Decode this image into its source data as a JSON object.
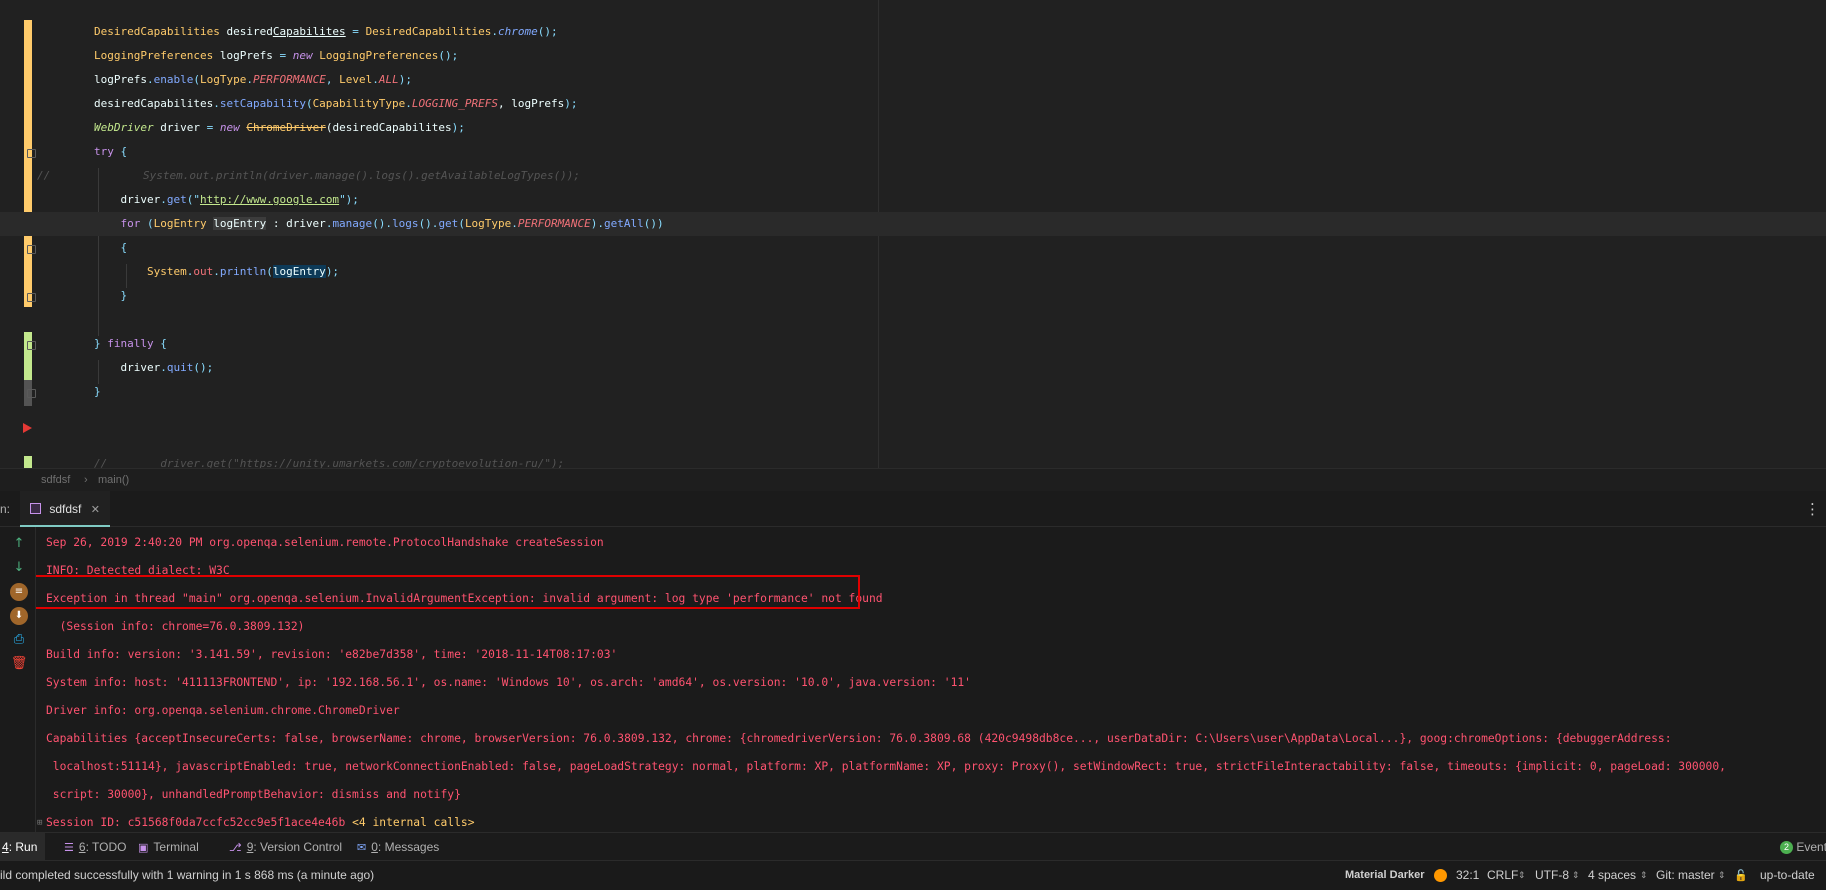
{
  "editor": {
    "lines": [
      [
        {
          "t": "DesiredCapabilities",
          "c": "#ffcb6b"
        },
        {
          "t": " desired",
          "c": "#eeffff"
        },
        {
          "t": "Capabilites",
          "c": "#eeffff",
          "u": true
        },
        {
          "t": " = ",
          "c": "#89ddff"
        },
        {
          "t": "DesiredCapabilities",
          "c": "#ffcb6b"
        },
        {
          "t": ".",
          "c": "#89ddff"
        },
        {
          "t": "chrome",
          "c": "#82aaff",
          "i": true
        },
        {
          "t": "();",
          "c": "#89ddff"
        }
      ],
      [
        {
          "t": "LoggingPreferences",
          "c": "#ffcb6b"
        },
        {
          "t": " logPrefs ",
          "c": "#eeffff"
        },
        {
          "t": "= ",
          "c": "#89ddff"
        },
        {
          "t": "new ",
          "c": "#c792ea",
          "i": true
        },
        {
          "t": "LoggingPreferences",
          "c": "#ffcb6b"
        },
        {
          "t": "();",
          "c": "#89ddff"
        }
      ],
      [
        {
          "t": "logPrefs",
          "c": "#eeffff"
        },
        {
          "t": ".",
          "c": "#89ddff"
        },
        {
          "t": "enable",
          "c": "#82aaff"
        },
        {
          "t": "(",
          "c": "#89ddff"
        },
        {
          "t": "LogType",
          "c": "#ffcb6b"
        },
        {
          "t": ".",
          "c": "#89ddff"
        },
        {
          "t": "PERFORMANCE",
          "c": "#f07178",
          "i": true
        },
        {
          "t": ", ",
          "c": "#89ddff"
        },
        {
          "t": "Level",
          "c": "#ffcb6b"
        },
        {
          "t": ".",
          "c": "#89ddff"
        },
        {
          "t": "ALL",
          "c": "#f07178",
          "i": true
        },
        {
          "t": ");",
          "c": "#89ddff"
        }
      ],
      [
        {
          "t": "desiredCapabilites",
          "c": "#eeffff"
        },
        {
          "t": ".",
          "c": "#89ddff"
        },
        {
          "t": "setCapability",
          "c": "#82aaff"
        },
        {
          "t": "(",
          "c": "#89ddff"
        },
        {
          "t": "CapabilityType",
          "c": "#ffcb6b"
        },
        {
          "t": ".",
          "c": "#89ddff"
        },
        {
          "t": "LOGGING_PREFS",
          "c": "#f07178",
          "i": true
        },
        {
          "t": ", logPrefs",
          "c": "#eeffff"
        },
        {
          "t": ");",
          "c": "#89ddff"
        }
      ],
      [
        {
          "t": "WebDriver",
          "c": "#c3e88d",
          "i": true
        },
        {
          "t": " driver ",
          "c": "#eeffff"
        },
        {
          "t": "= ",
          "c": "#89ddff"
        },
        {
          "t": "new ",
          "c": "#c792ea",
          "i": true
        },
        {
          "t": "ChromeDriver",
          "c": "#ffcb6b",
          "s": true
        },
        {
          "t": "(desiredCapabilites",
          "c": "#eeffff"
        },
        {
          "t": ");",
          "c": "#89ddff"
        }
      ],
      [
        {
          "t": "try ",
          "c": "#c792ea"
        },
        {
          "t": "{",
          "c": "#89ddff"
        }
      ],
      [
        {
          "t": "//",
          "c": "#545454",
          "i": true
        },
        {
          "t": "              System.out.println(driver.manage().logs().getAvailableLogTypes());",
          "c": "#545454",
          "i": true
        }
      ],
      [
        {
          "t": "    driver",
          "c": "#eeffff"
        },
        {
          "t": ".",
          "c": "#89ddff"
        },
        {
          "t": "get",
          "c": "#82aaff"
        },
        {
          "t": "(\"",
          "c": "#89ddff"
        },
        {
          "t": "http://www.google.com",
          "c": "#c3e88d",
          "u": true
        },
        {
          "t": "\");",
          "c": "#89ddff"
        }
      ],
      [
        {
          "t": "    for ",
          "c": "#c792ea"
        },
        {
          "t": "(",
          "c": "#89ddff"
        },
        {
          "t": "LogEntry ",
          "c": "#ffcb6b"
        },
        {
          "t": "logEntry",
          "c": "#eeffff",
          "bg": "#3c3c3c"
        },
        {
          "t": " : driver",
          "c": "#eeffff"
        },
        {
          "t": ".",
          "c": "#89ddff"
        },
        {
          "t": "manage",
          "c": "#82aaff"
        },
        {
          "t": "().",
          "c": "#89ddff"
        },
        {
          "t": "logs",
          "c": "#82aaff"
        },
        {
          "t": "().",
          "c": "#89ddff"
        },
        {
          "t": "get",
          "c": "#82aaff"
        },
        {
          "t": "(",
          "c": "#89ddff"
        },
        {
          "t": "LogType",
          "c": "#ffcb6b"
        },
        {
          "t": ".",
          "c": "#89ddff"
        },
        {
          "t": "PERFORMANCE",
          "c": "#f07178",
          "i": true
        },
        {
          "t": ").",
          "c": "#89ddff"
        },
        {
          "t": "getAll",
          "c": "#82aaff"
        },
        {
          "t": "())",
          "c": "#89ddff"
        }
      ],
      [
        {
          "t": "    {",
          "c": "#89ddff"
        }
      ],
      [
        {
          "t": "        System",
          "c": "#ffcb6b"
        },
        {
          "t": ".",
          "c": "#89ddff"
        },
        {
          "t": "out",
          "c": "#f07178"
        },
        {
          "t": ".",
          "c": "#89ddff"
        },
        {
          "t": "println",
          "c": "#82aaff"
        },
        {
          "t": "(",
          "c": "#89ddff"
        },
        {
          "t": "logEntry",
          "c": "#eeffff",
          "bg": "#0d3a58"
        },
        {
          "t": ");",
          "c": "#89ddff"
        }
      ],
      [
        {
          "t": "    }",
          "c": "#89ddff"
        }
      ],
      [],
      [
        {
          "t": "} ",
          "c": "#89ddff"
        },
        {
          "t": "finally ",
          "c": "#c792ea"
        },
        {
          "t": "{",
          "c": "#89ddff"
        }
      ],
      [
        {
          "t": "    driver",
          "c": "#eeffff"
        },
        {
          "t": ".",
          "c": "#89ddff"
        },
        {
          "t": "quit",
          "c": "#82aaff"
        },
        {
          "t": "();",
          "c": "#89ddff"
        }
      ],
      [
        {
          "t": "}",
          "c": "#89ddff"
        }
      ],
      [],
      [],
      [
        {
          "t": "//",
          "c": "#545454",
          "i": true
        },
        {
          "t": "        driver.get(\"https://unity.umarkets.com/cryptoevolution-ru/\");",
          "c": "#545454",
          "i": true
        }
      ]
    ]
  },
  "breadcrumb": {
    "class": "sdfdsf",
    "separator": "›",
    "method": "main()"
  },
  "run_window": {
    "prefix": "n:",
    "tab_label": "sdfdsf",
    "tab_close": "✕",
    "menu_icon": "⋮"
  },
  "console": {
    "lines": [
      {
        "text": "Sep 26, 2019 2:40:20 PM org.openqa.selenium.remote.ProtocolHandshake createSession",
        "color": "#ff5370"
      },
      {
        "text": "INFO: Detected dialect: W3C",
        "color": "#ff5370"
      },
      {
        "text": "Exception in thread \"main\" org.openqa.selenium.InvalidArgumentException: invalid argument: log type 'performance' not found",
        "color": "#ff5370"
      },
      {
        "text": "  (Session info: chrome=76.0.3809.132)",
        "color": "#ff5370"
      },
      {
        "text": "Build info: version: '3.141.59', revision: 'e82be7d358', time: '2018-11-14T08:17:03'",
        "color": "#ff5370"
      },
      {
        "text": "System info: host: '411113FRONTEND', ip: '192.168.56.1', os.name: 'Windows 10', os.arch: 'amd64', os.version: '10.0', java.version: '11'",
        "color": "#ff5370"
      },
      {
        "text": "Driver info: org.openqa.selenium.chrome.ChromeDriver",
        "color": "#ff5370"
      },
      {
        "text": "Capabilities {acceptInsecureCerts: false, browserName: chrome, browserVersion: 76.0.3809.132, chrome: {chromedriverVersion: 76.0.3809.68 (420c9498db8ce..., userDataDir: C:\\Users\\user\\AppData\\Local...}, goog:chromeOptions: {debuggerAddress:",
        "color": "#ff5370"
      },
      {
        "text": " localhost:51114}, javascriptEnabled: true, networkConnectionEnabled: false, pageLoadStrategy: normal, platform: XP, platformName: XP, proxy: Proxy(), setWindowRect: true, strictFileInteractability: false, timeouts: {implicit: 0, pageLoad: 300000,",
        "color": "#ff5370"
      },
      {
        "text": " script: 30000}, unhandledPromptBehavior: dismiss and notify}",
        "color": "#ff5370"
      },
      {
        "text": "Session ID: c51568f0da7ccfc52cc9e5f1ace4e46b",
        "color": "#ff5370",
        "suffix": " <4 internal calls>",
        "suffix_color": "#ffcb6b"
      }
    ],
    "expand_marker": "⊞",
    "highlight_color": "#e00000"
  },
  "bottom_tabs": [
    {
      "num": "4",
      "label": ": Run",
      "icon": "",
      "active": true
    },
    {
      "num": "6",
      "label": ": TODO",
      "icon": "☰",
      "active": false
    },
    {
      "num": "",
      "label": "Terminal",
      "icon": "▣",
      "active": false
    },
    {
      "num": "9",
      "label": ": Version Control",
      "icon": "⎇",
      "active": false
    },
    {
      "num": "0",
      "label": ": Messages",
      "icon": "✉",
      "active": false
    }
  ],
  "event_log": {
    "count": "2",
    "label": "Event L"
  },
  "status_bar": {
    "message": "ild completed successfully with 1 warning in 1 s 868 ms (a minute ago)",
    "theme": "Material Darker",
    "position": "32:1",
    "line_sep": "CRLF",
    "encoding": "UTF-8",
    "indent": "4 spaces",
    "vcs": "Git: master",
    "status": "up-to-date",
    "theme_color": "#ff9800"
  }
}
